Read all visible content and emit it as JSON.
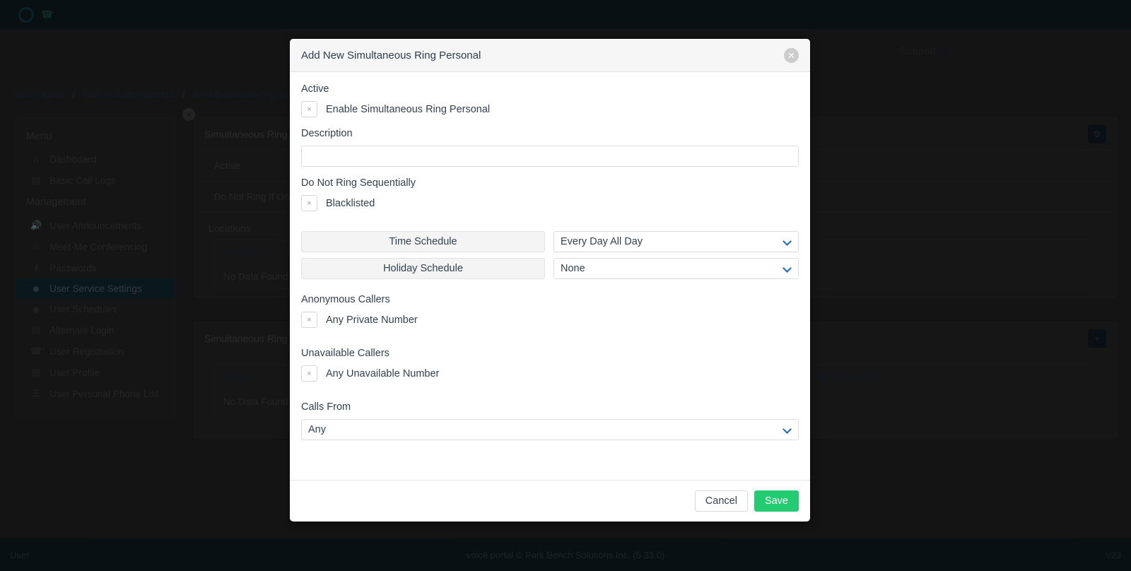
{
  "topbar": {
    "brand_phone_icon": "phone-icon",
    "brand_name": "",
    "support_label": "Support"
  },
  "breadcrumb": {
    "items": [
      "Dashboard",
      "Call-feature-settings",
      "Simultaneous-ring-personal"
    ],
    "separator": "/"
  },
  "sidebar": {
    "menu_heading": "Menu",
    "management_heading": "Management",
    "menu_items": [
      {
        "label": "Dashboard",
        "icon": "home-icon",
        "glyph": "⌂"
      },
      {
        "label": "Basic Call Logs",
        "icon": "list-grid-icon",
        "glyph": "▤"
      }
    ],
    "management_items": [
      {
        "label": "User Announcements",
        "icon": "megaphone-icon",
        "glyph": "◄)"
      },
      {
        "label": "Meet-Me Conferencing",
        "icon": "conference-icon",
        "glyph": "⚉"
      },
      {
        "label": "Passwords",
        "icon": "key-icon",
        "glyph": "⚷"
      },
      {
        "label": "User Service Settings",
        "icon": "user-gear-icon",
        "glyph": "☺"
      },
      {
        "label": "User Schedules",
        "icon": "user-clock-icon",
        "glyph": "☻"
      },
      {
        "label": "Alternate Login",
        "icon": "id-card-icon",
        "glyph": "▤"
      },
      {
        "label": "User Registration",
        "icon": "phone-icon",
        "glyph": "☎"
      },
      {
        "label": "User Profile",
        "icon": "profile-card-icon",
        "glyph": "▧"
      },
      {
        "label": "User Personal Phone List",
        "icon": "bullet-list-icon",
        "glyph": "☰"
      }
    ],
    "active_item": "User Service Settings"
  },
  "panel_top": {
    "title": "Simultaneous Ring Personal",
    "gear_icon": "gear-icon",
    "rows": [
      "Active",
      "Do Not Ring If On Call"
    ],
    "locations_label": "Locations",
    "table": {
      "columns": [
        "Number"
      ],
      "sort_caret": "▲",
      "empty_text": "No Data Found"
    }
  },
  "panel_bottom": {
    "title": "Simultaneous Ring Personal Criteria",
    "add_icon": "plus-icon",
    "table": {
      "columns": [
        "Name",
        "Do Not Ring Sequentially"
      ],
      "sort_caret": "▲",
      "empty_text": "No Data Found"
    }
  },
  "footer": {
    "left": "User",
    "center": "voice portal © Park Bench Solutions Inc. (5.33.0)",
    "right": "v23"
  },
  "modal": {
    "title": "Add New Simultaneous Ring Personal",
    "close_icon": "close-icon",
    "active": {
      "label": "Active",
      "checkbox_label": "Enable Simultaneous Ring Personal",
      "checkbox_glyph": "×"
    },
    "description": {
      "label": "Description",
      "value": "",
      "placeholder": ""
    },
    "do_not_ring": {
      "label": "Do Not Ring Sequentially",
      "checkbox_label": "Blacklisted",
      "checkbox_glyph": "×"
    },
    "schedules": [
      {
        "button_label": "Time Schedule",
        "select_value": "Every Day All Day",
        "chevron_icon": "chevron-down-icon"
      },
      {
        "button_label": "Holiday Schedule",
        "select_value": "None",
        "chevron_icon": "chevron-down-icon"
      }
    ],
    "anonymous": {
      "label": "Anonymous Callers",
      "checkbox_label": "Any Private Number",
      "checkbox_glyph": "×"
    },
    "unavailable": {
      "label": "Unavailable Callers",
      "checkbox_label": "Any Unavailable Number",
      "checkbox_glyph": "×"
    },
    "calls_from": {
      "label": "Calls From",
      "select_value": "Any",
      "chevron_icon": "chevron-down-icon"
    },
    "cancel_label": "Cancel",
    "save_label": "Save"
  },
  "colors": {
    "save_green": "#23cc71",
    "chevron_blue": "#1565d8",
    "sidebar_active": "#12333d",
    "topbar": "#132227"
  }
}
